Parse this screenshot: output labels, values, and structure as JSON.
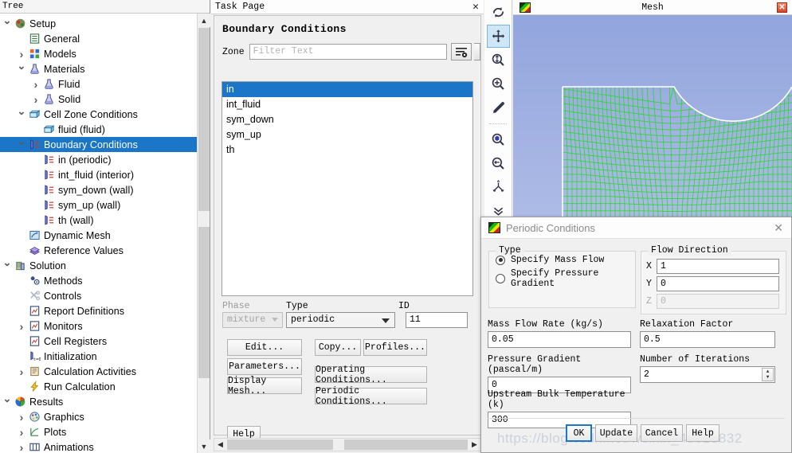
{
  "tree": {
    "header": "Tree",
    "items": [
      {
        "label": "Setup",
        "depth": 0,
        "twisty": "down",
        "icon": "setup-icon",
        "selected": false
      },
      {
        "label": "General",
        "depth": 1,
        "twisty": "",
        "icon": "general-icon",
        "selected": false
      },
      {
        "label": "Models",
        "depth": 1,
        "twisty": "right",
        "icon": "models-icon",
        "selected": false
      },
      {
        "label": "Materials",
        "depth": 1,
        "twisty": "down",
        "icon": "materials-icon",
        "selected": false
      },
      {
        "label": "Fluid",
        "depth": 2,
        "twisty": "right",
        "icon": "fluid-icon",
        "selected": false
      },
      {
        "label": "Solid",
        "depth": 2,
        "twisty": "right",
        "icon": "solid-icon",
        "selected": false
      },
      {
        "label": "Cell Zone Conditions",
        "depth": 1,
        "twisty": "down",
        "icon": "cellzone-icon",
        "selected": false
      },
      {
        "label": "fluid (fluid)",
        "depth": 2,
        "twisty": "",
        "icon": "cellzone-icon",
        "selected": false
      },
      {
        "label": "Boundary Conditions",
        "depth": 1,
        "twisty": "down",
        "icon": "boundary-icon",
        "selected": true
      },
      {
        "label": "in (periodic)",
        "depth": 2,
        "twisty": "",
        "icon": "boundary-icon",
        "selected": false
      },
      {
        "label": "int_fluid (interior)",
        "depth": 2,
        "twisty": "",
        "icon": "boundary-icon",
        "selected": false
      },
      {
        "label": "sym_down (wall)",
        "depth": 2,
        "twisty": "",
        "icon": "boundary-icon",
        "selected": false
      },
      {
        "label": "sym_up (wall)",
        "depth": 2,
        "twisty": "",
        "icon": "boundary-icon",
        "selected": false
      },
      {
        "label": "th (wall)",
        "depth": 2,
        "twisty": "",
        "icon": "boundary-icon",
        "selected": false
      },
      {
        "label": "Dynamic Mesh",
        "depth": 1,
        "twisty": "",
        "icon": "dynamicmesh-icon",
        "selected": false
      },
      {
        "label": "Reference Values",
        "depth": 1,
        "twisty": "",
        "icon": "refvalues-icon",
        "selected": false
      },
      {
        "label": "Solution",
        "depth": 0,
        "twisty": "down",
        "icon": "solution-icon",
        "selected": false
      },
      {
        "label": "Methods",
        "depth": 1,
        "twisty": "",
        "icon": "methods-icon",
        "selected": false
      },
      {
        "label": "Controls",
        "depth": 1,
        "twisty": "",
        "icon": "controls-icon",
        "selected": false
      },
      {
        "label": "Report Definitions",
        "depth": 1,
        "twisty": "",
        "icon": "report-icon",
        "selected": false
      },
      {
        "label": "Monitors",
        "depth": 1,
        "twisty": "right",
        "icon": "report-icon",
        "selected": false
      },
      {
        "label": "Cell Registers",
        "depth": 1,
        "twisty": "",
        "icon": "report-icon",
        "selected": false
      },
      {
        "label": "Initialization",
        "depth": 1,
        "twisty": "",
        "icon": "initialization-icon",
        "selected": false
      },
      {
        "label": "Calculation Activities",
        "depth": 1,
        "twisty": "right",
        "icon": "calcactivities-icon",
        "selected": false
      },
      {
        "label": "Run Calculation",
        "depth": 1,
        "twisty": "",
        "icon": "runcalc-icon",
        "selected": false
      },
      {
        "label": "Results",
        "depth": 0,
        "twisty": "down",
        "icon": "results-icon",
        "selected": false
      },
      {
        "label": "Graphics",
        "depth": 1,
        "twisty": "right",
        "icon": "graphics-icon",
        "selected": false
      },
      {
        "label": "Plots",
        "depth": 1,
        "twisty": "right",
        "icon": "plots-icon",
        "selected": false
      },
      {
        "label": "Animations",
        "depth": 1,
        "twisty": "right",
        "icon": "animations-icon",
        "selected": false
      }
    ]
  },
  "task_page": {
    "title": "Task Page",
    "close_label": "✕",
    "heading": "Boundary Conditions",
    "zone_label": "Zone",
    "filter_placeholder": "Filter Text",
    "filter_value": "",
    "zones": [
      "in",
      "int_fluid",
      "sym_down",
      "sym_up",
      "th"
    ],
    "selected_zone": "in",
    "phase_label": "Phase",
    "phase_value": "mixture",
    "type_label": "Type",
    "type_value": "periodic",
    "id_label": "ID",
    "id_value": "11",
    "buttons": {
      "edit": "Edit...",
      "parameters": "Parameters...",
      "display_mesh": "Display Mesh...",
      "copy": "Copy...",
      "profiles": "Profiles...",
      "operating_conditions": "Operating Conditions...",
      "periodic_conditions": "Periodic Conditions...",
      "help": "Help"
    }
  },
  "toolbar": {
    "items": [
      {
        "name": "rotate-icon",
        "active": false
      },
      {
        "name": "pan-move-icon",
        "active": true
      },
      {
        "name": "zoom-field-icon",
        "active": false
      },
      {
        "name": "zoom-in-icon",
        "active": false
      },
      {
        "name": "probe-picker-icon",
        "active": false
      },
      {
        "name": "zoom-to-object-icon",
        "active": false
      },
      {
        "name": "zoom-out-icon",
        "active": false
      },
      {
        "name": "mesh-split-icon",
        "active": false
      },
      {
        "name": "chevron-double-down-icon",
        "active": false
      }
    ]
  },
  "mesh_window": {
    "title": "Mesh",
    "icon": "fluent-mesh-icon",
    "close_label": "✕",
    "mesh_color": "#2ee02e",
    "outline_color": "#ffffff",
    "background_top": "#9fb0e0",
    "background_bottom": "#e8ecf8"
  },
  "periodic_dialog": {
    "title": "Periodic Conditions",
    "icon": "fluent-panel-icon",
    "close_label": "✕",
    "type_group_label": "Type",
    "type_options": [
      {
        "label": "Specify Mass Flow",
        "selected": true
      },
      {
        "label": "Specify Pressure Gradient",
        "selected": false
      }
    ],
    "flow_direction_label": "Flow Direction",
    "flow_direction": [
      {
        "axis": "X",
        "value": "1",
        "disabled": false
      },
      {
        "axis": "Y",
        "value": "0",
        "disabled": false
      },
      {
        "axis": "Z",
        "value": "0",
        "disabled": true
      }
    ],
    "mass_flow_rate_label": "Mass Flow Rate (kg/s)",
    "mass_flow_rate_value": "0.05",
    "pressure_gradient_label": "Pressure Gradient (pascal/m)",
    "pressure_gradient_value": "0",
    "upstream_bulk_temperature_label": "Upstream Bulk Temperature (k)",
    "upstream_bulk_temperature_value": "300",
    "relaxation_factor_label": "Relaxation Factor",
    "relaxation_factor_value": "0.5",
    "number_of_iterations_label": "Number of Iterations",
    "number_of_iterations_value": "2",
    "buttons": {
      "ok": "OK",
      "update": "Update",
      "cancel": "Cancel",
      "help": "Help"
    },
    "watermark": "https://blog.csdn.net/weixin_48615832"
  },
  "colors": {
    "selection_blue": "#1c76c8",
    "focus_blue": "#1c76c8",
    "mesh_green": "#2ee02e"
  }
}
